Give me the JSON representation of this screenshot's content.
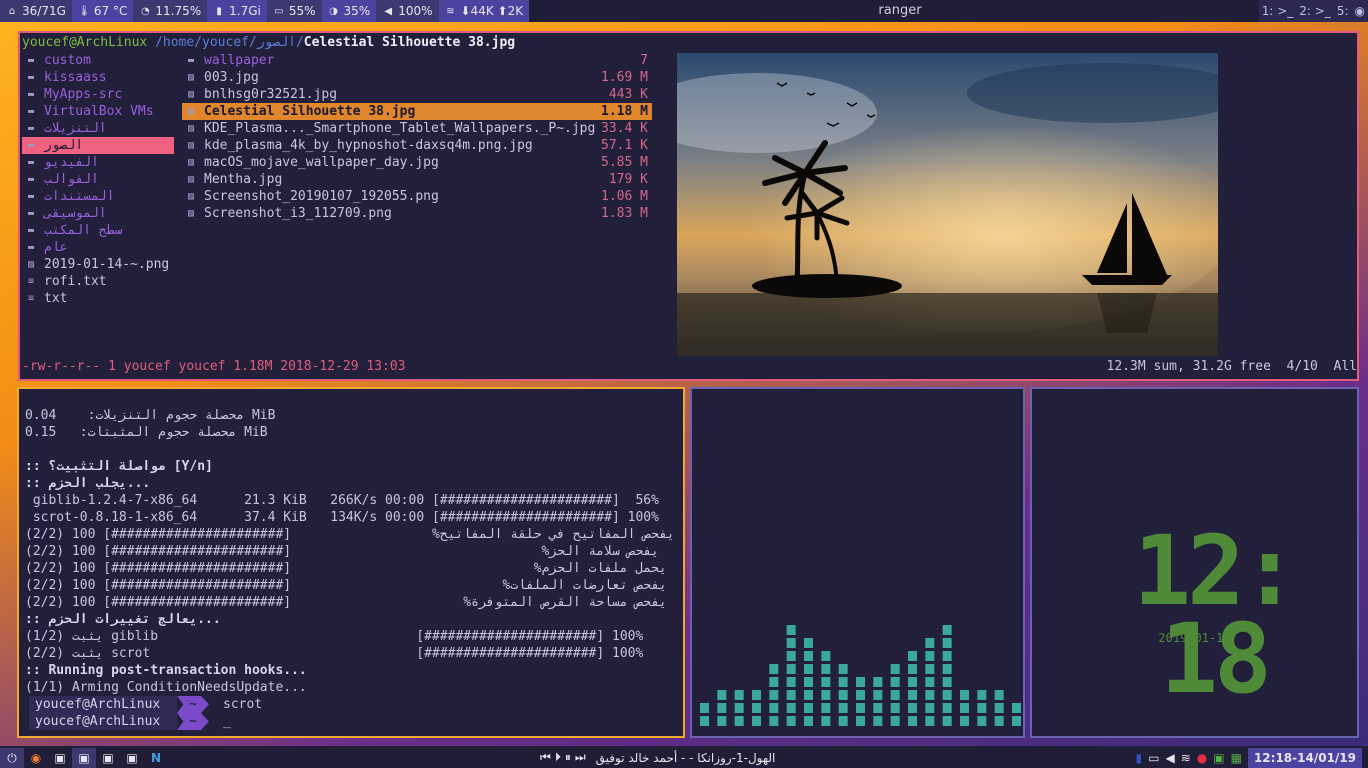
{
  "topbar": {
    "home_value": "36/71G",
    "temp_value": "67 °C",
    "cpu_value": "11.75%",
    "mem_value": "1.7Gi",
    "battery_value": "55%",
    "brightness_value": "35%",
    "volume_value": "100%",
    "net_value": "⬇44K ⬆2K",
    "window_title": "ranger",
    "workspaces": [
      "1: >_",
      "2: >_",
      "5:"
    ]
  },
  "ranger": {
    "user_host": "youcef@ArchLinux",
    "path": "/home/youcef/الصور/",
    "current_file": "Celestial Silhouette 38.jpg",
    "parent_dir": [
      {
        "name": "custom",
        "type": "dir"
      },
      {
        "name": "kissaass",
        "type": "dir"
      },
      {
        "name": "MyApps-src",
        "type": "dir"
      },
      {
        "name": "VirtualBox VMs",
        "type": "dir"
      },
      {
        "name": "التنزيلات",
        "type": "dir"
      },
      {
        "name": "الصور",
        "type": "dir",
        "selected": true
      },
      {
        "name": "الفيديو",
        "type": "dir"
      },
      {
        "name": "القوالب",
        "type": "dir"
      },
      {
        "name": "المستندات",
        "type": "dir"
      },
      {
        "name": "الموسيقى",
        "type": "dir"
      },
      {
        "name": "سطح المكتب",
        "type": "dir"
      },
      {
        "name": "عام",
        "type": "dir"
      },
      {
        "name": "2019-01-14-~.png",
        "type": "image"
      },
      {
        "name": "rofi.txt",
        "type": "text"
      },
      {
        "name": "txt",
        "type": "text"
      }
    ],
    "files": [
      {
        "name": "wallpaper",
        "size": "7",
        "type": "dir"
      },
      {
        "name": "003.jpg",
        "size": "1.69 M",
        "type": "image"
      },
      {
        "name": "bnlhsg0r32521.jpg",
        "size": "443 K",
        "type": "image"
      },
      {
        "name": "Celestial Silhouette 38.jpg",
        "size": "1.18 M",
        "type": "image",
        "selected": true
      },
      {
        "name": "KDE_Plasma..._Smartphone_Tablet_Wallpapers._P~.jpg",
        "size": "33.4 K",
        "type": "image"
      },
      {
        "name": "kde_plasma_4k_by_hypnoshot-daxsq4m.png.jpg",
        "size": "57.1 K",
        "type": "image"
      },
      {
        "name": "macOS_mojave_wallpaper_day.jpg",
        "size": "5.85 M",
        "type": "image"
      },
      {
        "name": "Mentha.jpg",
        "size": "179 K",
        "type": "image"
      },
      {
        "name": "Screenshot_20190107_192055.png",
        "size": "1.06 M",
        "type": "image"
      },
      {
        "name": "Screenshot_i3_112709.png",
        "size": "1.83 M",
        "type": "image"
      }
    ],
    "status_left": "-rw-r--r-- 1 youcef youcef 1.18M 2018-12-29 13:03",
    "status_right": "12.3M sum, 31.2G free  4/10  All"
  },
  "terminal": {
    "lines": [
      {
        "text": "محصلة حجوم التنزيلات:    0.04 MiB",
        "color": "#c9c5e0"
      },
      {
        "text": "محصلة حجوم المثبتات:   0.15 MiB",
        "color": "#c9c5e0"
      },
      {
        "text": "",
        "color": "#c9c5e0"
      },
      {
        "text": ":: مواصلة التثبيت؟ [Y/n]",
        "color": "#c9c5e0"
      },
      {
        "text": ":: يجلب الحزم...",
        "color": "#c9c5e0"
      },
      {
        "text": " giblib-1.2.4-7-x86_64      21.3 KiB   266K/s 00:00 [######################]  56%",
        "color": "#c9c5e0"
      },
      {
        "text": " scrot-0.8.18-1-x86_64      37.4 KiB   134K/s 00:00 [######################] 100%",
        "color": "#c9c5e0"
      },
      {
        "text": "(2/2) 100 [######################]                  %يفحص المفاتيح في حلقة المفاتيح",
        "color": "#c9c5e0"
      },
      {
        "text": "(2/2) 100 [######################]                                %يفحص سلامة الحز",
        "color": "#c9c5e0"
      },
      {
        "text": "(2/2) 100 [######################]                               %يحمل ملفات الحزم",
        "color": "#c9c5e0"
      },
      {
        "text": "(2/2) 100 [######################]                           %يفحص تعارضات الملفات",
        "color": "#c9c5e0"
      },
      {
        "text": "(2/2) 100 [######################]                      %يفحص مساحة القرص المتوفرة",
        "color": "#c9c5e0"
      },
      {
        "text": ":: يعالج تغييرات الحزم...",
        "color": "#c9c5e0"
      },
      {
        "text": "(1/2) يثبت giblib                                 [######################] 100%",
        "color": "#c9c5e0"
      },
      {
        "text": "(2/2) يثبت scrot                                  [######################] 100%",
        "color": "#c9c5e0"
      },
      {
        "text": ":: Running post-transaction hooks...",
        "color": "#c9c5e0"
      },
      {
        "text": "(1/1) Arming ConditionNeedsUpdate...",
        "color": "#c9c5e0"
      }
    ],
    "prompts": [
      {
        "user": "youcef@ArchLinux",
        "dir": "~",
        "cmd": "scrot"
      },
      {
        "user": "youcef@ArchLinux",
        "dir": "~",
        "cmd": "_"
      }
    ]
  },
  "visualizer": {
    "levels": [
      0.18,
      0.3,
      0.26,
      0.28,
      0.46,
      0.66,
      0.62,
      0.52,
      0.45,
      0.38,
      0.38,
      0.48,
      0.5,
      0.62,
      0.66,
      0.3,
      0.28,
      0.3,
      0.18
    ],
    "color": "#3aa89a"
  },
  "clock": {
    "time": "12: 18",
    "date": "2019-01-14"
  },
  "bottombar": {
    "now_playing": "الهول-1-روزانكا -  - أحمد خالد توفيق",
    "datetime": "12:18-14/01/19"
  },
  "colors": {
    "accent": "#4a44a0",
    "ranger_border": "#e05c7c",
    "terminal_border": "#f0a830",
    "panel_border": "#6a63b0"
  }
}
